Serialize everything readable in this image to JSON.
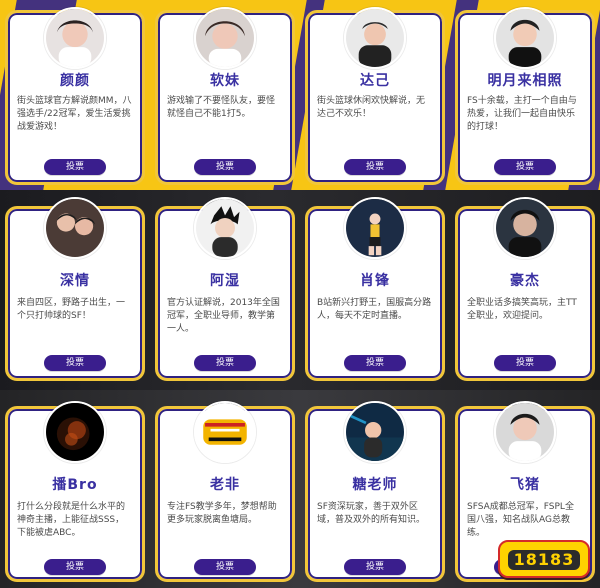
{
  "cards": [
    {
      "name": "颜颜",
      "desc": "街头篮球官方解说颜MM，八强选手/22冠军，爱生活爱挑战爱游戏！",
      "vote": "投票",
      "avatar": "woman-avatar"
    },
    {
      "name": "软妹",
      "desc": "游戏输了不要怪队友，要怪就怪自己不能1打5。",
      "vote": "投票",
      "avatar": "woman-avatar"
    },
    {
      "name": "达己",
      "desc": "街头篮球休闲欢快解说，无达己不欢乐！",
      "vote": "投票",
      "avatar": "man-avatar"
    },
    {
      "name": "明月来相照",
      "desc": "FS十余载，主打一个自由与热爱，让我们一起自由快乐的打球！",
      "vote": "投票",
      "avatar": "man-avatar"
    },
    {
      "name": "深情",
      "desc": "来自四区，野路子出生，一个只打帅球的SF！",
      "vote": "投票",
      "avatar": "man-avatar"
    },
    {
      "name": "阿湿",
      "desc": "官方认证解说，2013年全国冠军，全职业导师，教学第一人。",
      "vote": "投票",
      "avatar": "anime-avatar"
    },
    {
      "name": "肖锋",
      "desc": "B站新兴打野王，国服高分路人，每天不定时直播。",
      "vote": "投票",
      "avatar": "player-avatar"
    },
    {
      "name": "豪杰",
      "desc": "全职业话多搞笑高玩，主TT全职业，欢迎提问。",
      "vote": "投票",
      "avatar": "man-avatar"
    },
    {
      "name": "播Bro",
      "desc": "打什么分段就是什么水平的神奇主播，上能征战SSS，下能被虐ABC。",
      "vote": "投票",
      "avatar": "dark-avatar"
    },
    {
      "name": "老非",
      "desc": "专注FS教学多年，梦想帮助更多玩家脱离鱼塘局。",
      "vote": "投票",
      "avatar": "freestyle-logo"
    },
    {
      "name": "糖老师",
      "desc": "SF资深玩家，善于双外区域，普及双外的所有知识。",
      "vote": "投票",
      "avatar": "stage-avatar"
    },
    {
      "name": "飞猪",
      "desc": "SFSA成都总冠军，FSPL全国八强，知名战队AG总教练。",
      "vote": "投票",
      "avatar": "man-avatar"
    }
  ],
  "logo": {
    "text": "18183"
  },
  "theme": {
    "accent": "#3a1e8d",
    "name": "#3a31a2",
    "border": "#f1c63a"
  }
}
